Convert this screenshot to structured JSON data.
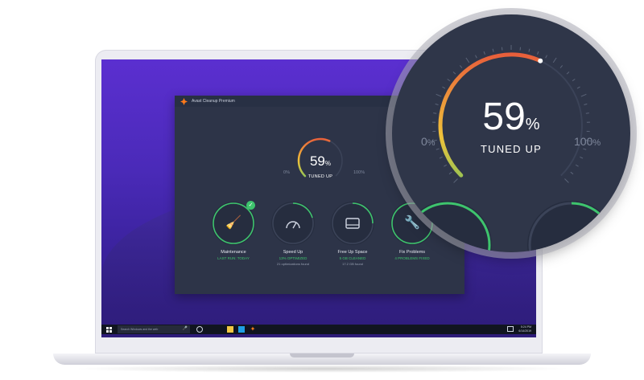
{
  "window": {
    "title": "Avast Cleanup Premium"
  },
  "gauge": {
    "percent": "59",
    "percent_value": 59,
    "percent_symbol": "%",
    "label": "TUNED UP",
    "min_label": "0",
    "max_label": "100",
    "unit": "%"
  },
  "cards": [
    {
      "title": "Maintenance",
      "status": "LAST RUN: TODAY",
      "detail": "",
      "icon": "broom-icon",
      "checked": true
    },
    {
      "title": "Speed Up",
      "status": "13% OPTIMIZED",
      "detail": "21 optimizations found",
      "icon": "speedometer-icon",
      "checked": false
    },
    {
      "title": "Free Up Space",
      "status": "5 GB CLEANED",
      "detail": "17.2 GB found",
      "icon": "hard-drive-icon",
      "checked": false
    },
    {
      "title": "Fix Problems",
      "status": "4 PROBLEMS FIXED",
      "detail": "",
      "icon": "wrench-icon",
      "checked": true
    }
  ],
  "taskbar": {
    "search_placeholder": "Search Windows and the web",
    "clock_time": "5:24 PM",
    "clock_date": "6/14/2019"
  },
  "colors": {
    "accent_green": "#3ec46d",
    "app_bg": "#2d3448",
    "brand_orange": "#ff7a1a"
  }
}
